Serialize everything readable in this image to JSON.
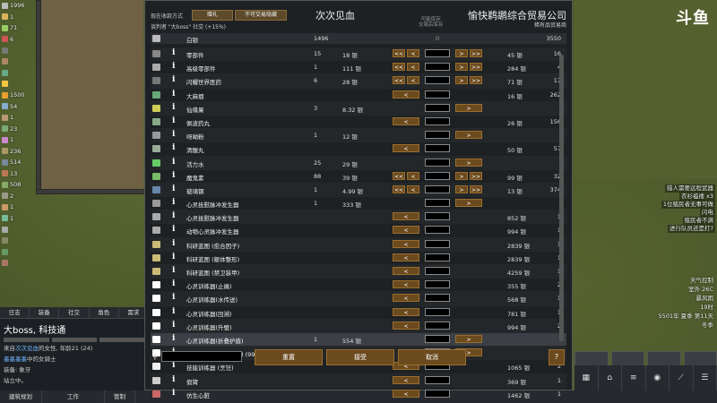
{
  "dialog": {
    "pay_mode_label": "现在收款方式",
    "btn_gift": "赠礼",
    "btn_show_sellable": "不可交易隐藏",
    "trade_with_line": "谈判者 \"大boss\" 社交 (+15%)",
    "title": "次次见血",
    "col_header": "可能库存\n交易后库存",
    "trader_name": "愉快鹈鹕综合贸易公司",
    "trader_type": "稀有品贸易商",
    "silver": {
      "label": "白银",
      "colony": "1496",
      "mid": "0",
      "trader": "3550"
    },
    "rows": [
      {
        "name": "零部件",
        "colony": "15",
        "buy": "18 银",
        "sell": "45 银",
        "trader": "16",
        "left": true,
        "right": true
      },
      {
        "name": "高级零部件",
        "colony": "1",
        "buy": "111 银",
        "sell": "284 银",
        "trader": "4",
        "left": true,
        "right": true
      },
      {
        "name": "闪耀世界医药",
        "colony": "6",
        "buy": "28 银",
        "sell": "71 银",
        "trader": "17",
        "left": true,
        "right": true
      },
      {
        "name": "大麻烟",
        "colony": "",
        "buy": "",
        "sell": "16 银",
        "trader": "262",
        "left": true,
        "right": false
      },
      {
        "name": "仙缘果",
        "colony": "3",
        "buy": "8.32 银",
        "sell": "",
        "trader": "",
        "left": false,
        "right": true
      },
      {
        "name": "佩波药丸",
        "colony": "",
        "buy": "",
        "sell": "26 银",
        "trader": "156",
        "left": true,
        "right": false
      },
      {
        "name": "呀呦粉",
        "colony": "1",
        "buy": "12 银",
        "sell": "",
        "trader": "",
        "left": false,
        "right": true
      },
      {
        "name": "清醒丸",
        "colony": "",
        "buy": "",
        "sell": "50 银",
        "trader": "57",
        "left": true,
        "right": false
      },
      {
        "name": "活力水",
        "colony": "25",
        "buy": "29 银",
        "sell": "",
        "trader": "",
        "left": false,
        "right": true
      },
      {
        "name": "魔鬼素",
        "colony": "88",
        "buy": "39 银",
        "sell": "99 银",
        "trader": "32",
        "left": true,
        "right": true
      },
      {
        "name": "玻璃钢",
        "colony": "1",
        "buy": "4.99 银",
        "sell": "13 银",
        "trader": "374",
        "left": true,
        "right": true
      },
      {
        "name": "心灵抚慰脉冲发生器",
        "colony": "1",
        "buy": "333 银",
        "sell": "",
        "trader": "",
        "left": false,
        "right": true
      },
      {
        "name": "心灵抚慰脉冲发生器",
        "colony": "",
        "buy": "",
        "sell": "852 银",
        "trader": "1",
        "left": true,
        "right": false
      },
      {
        "name": "动物心灵脉冲发生器",
        "colony": "",
        "buy": "",
        "sell": "994 银",
        "trader": "1",
        "left": true,
        "right": false
      },
      {
        "name": "科研蓝图 (愈合因子)",
        "colony": "",
        "buy": "",
        "sell": "2839 银",
        "trader": "1",
        "left": true,
        "right": false
      },
      {
        "name": "科研蓝图 (躯体整形)",
        "colony": "",
        "buy": "",
        "sell": "2839 银",
        "trader": "1",
        "left": true,
        "right": false
      },
      {
        "name": "科研蓝图 (禁卫装甲)",
        "colony": "",
        "buy": "",
        "sell": "4259 银",
        "trader": "1",
        "left": true,
        "right": false
      },
      {
        "name": "心灵训练器(止痛)",
        "colony": "",
        "buy": "",
        "sell": "355 银",
        "trader": "2",
        "left": true,
        "right": false
      },
      {
        "name": "心灵训练器(水传送)",
        "colony": "",
        "buy": "",
        "sell": "568 银",
        "trader": "1",
        "left": true,
        "right": false
      },
      {
        "name": "心灵训练器(回溯)",
        "colony": "",
        "buy": "",
        "sell": "781 银",
        "trader": "1",
        "left": true,
        "right": false
      },
      {
        "name": "心灵训练器(升璧)",
        "colony": "",
        "buy": "",
        "sell": "994 银",
        "trader": "2",
        "left": true,
        "right": false
      },
      {
        "name": "心灵训练器(折叠护盾)",
        "colony": "1",
        "buy": "554 银",
        "sell": "",
        "trader": "",
        "left": false,
        "right": true,
        "hl": true
      },
      {
        "name": "心灵训练器(狂暴脉冲) (99%)",
        "colony": "1",
        "buy": "554 银",
        "sell": "",
        "trader": "",
        "left": false,
        "right": true
      },
      {
        "name": "技能训练器 (烹饪)",
        "colony": "",
        "buy": "",
        "sell": "1065 银",
        "trader": "2",
        "left": true,
        "right": false
      },
      {
        "name": "假臂",
        "colony": "",
        "buy": "",
        "sell": "369 银",
        "trader": "1",
        "left": true,
        "right": false
      },
      {
        "name": "仿生心脏",
        "colony": "",
        "buy": "",
        "sell": "1462 银",
        "trader": "1",
        "left": true,
        "right": false
      }
    ],
    "btn_reset": "重置",
    "btn_accept": "接受",
    "btn_cancel": "取消",
    "btn_help": "?",
    "search_placeholder": ""
  },
  "left_resources": [
    "1996",
    "1",
    "71",
    "6",
    "",
    "",
    "",
    "",
    "1500",
    "54",
    "1",
    "23",
    "1",
    "236",
    "514",
    "13",
    "508",
    "2",
    "1",
    "1",
    "",
    "",
    "",
    ""
  ],
  "tabs": [
    "日志",
    "装备",
    "社交",
    "角色",
    "需求"
  ],
  "inspect": {
    "name": "大boss, 科技通",
    "line1_pre": "来自",
    "line1_hl": "次次见血",
    "line1_post": "的女性, 年龄21 (24)",
    "line2_hl": "墨墨墨墨",
    "line2_post": "中的女骑士",
    "line3": "装备: 象牙",
    "line4": "站立中。"
  },
  "bottom_bar": [
    "建筑规划",
    "工作",
    "管制"
  ],
  "logo": "斗鱼",
  "alerts": [
    "猎人需要远程武器",
    "衣衫褴褛 x3",
    "1位殖民者无事可做",
    "闪电",
    "殖民者不满",
    "进行队员还是打?"
  ],
  "stats": [
    "天气控制",
    "室外 26C",
    "暴风雨",
    "19时",
    "5501年 夏季 第11天",
    "冬季"
  ],
  "colors": {
    "panel": "#1e2124",
    "button": "#6b4a1e",
    "accent": "#9a6f2e"
  }
}
